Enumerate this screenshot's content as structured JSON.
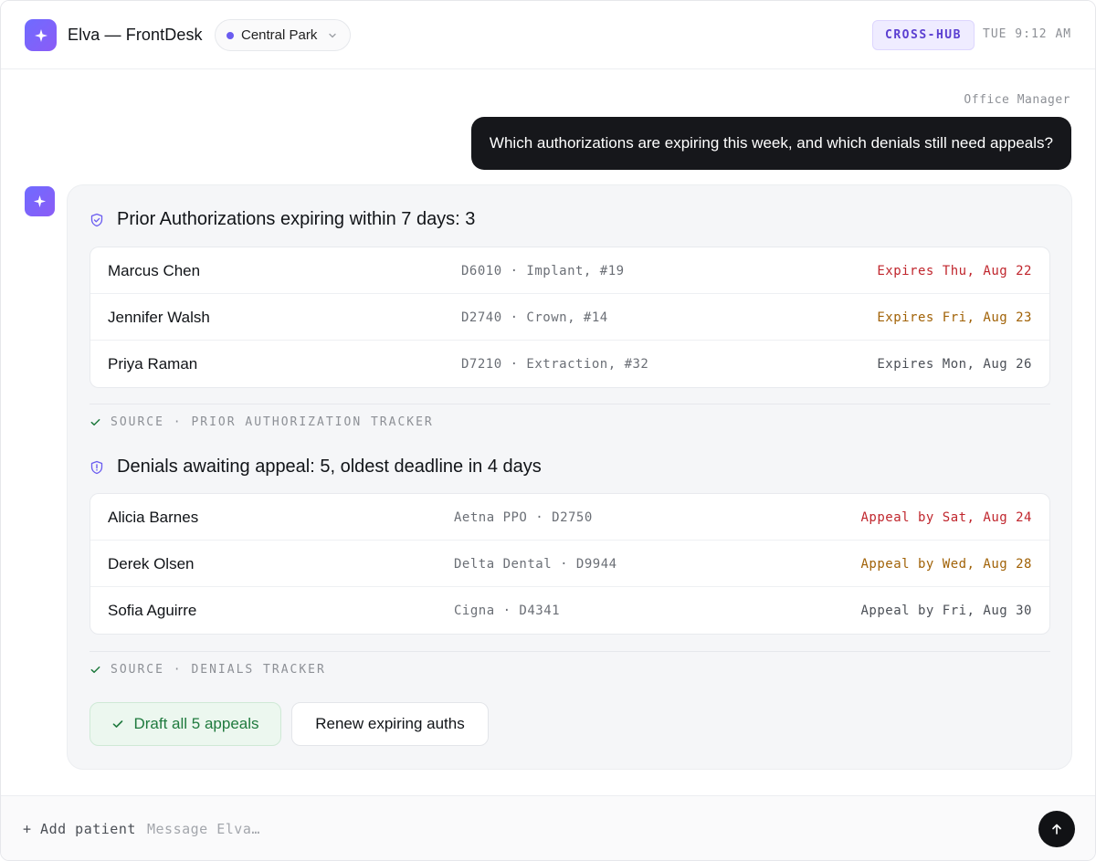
{
  "header": {
    "app_title": "Elva — FrontDesk",
    "location": "Central Park",
    "badge": "CROSS-HUB",
    "time": "TUE 9:12 AM"
  },
  "conversation": {
    "user_role": "Office Manager",
    "user_message": "Which authorizations are expiring this week, and which denials still need appeals?"
  },
  "auths": {
    "title": "Prior Authorizations expiring within 7 days: 3",
    "rows": [
      {
        "patient": "Marcus Chen",
        "procedure": "D6010 · Implant, #19",
        "status": "Expires Thu, Aug 22",
        "urgency": "critical"
      },
      {
        "patient": "Jennifer Walsh",
        "procedure": "D2740 · Crown, #14",
        "status": "Expires Fri, Aug 23",
        "urgency": "warning"
      },
      {
        "patient": "Priya Raman",
        "procedure": "D7210 · Extraction, #32",
        "status": "Expires Mon, Aug 26",
        "urgency": "normal"
      }
    ],
    "source": "SOURCE · PRIOR AUTHORIZATION TRACKER"
  },
  "denials": {
    "title": "Denials awaiting appeal: 5, oldest deadline in 4 days",
    "rows": [
      {
        "patient": "Alicia Barnes",
        "payer": "Aetna PPO · D2750",
        "status": "Appeal by Sat, Aug 24",
        "urgency": "critical"
      },
      {
        "patient": "Derek Olsen",
        "payer": "Delta Dental · D9944",
        "status": "Appeal by Wed, Aug 28",
        "urgency": "warning"
      },
      {
        "patient": "Sofia Aguirre",
        "payer": "Cigna · D4341",
        "status": "Appeal by Fri, Aug 30",
        "urgency": "normal"
      }
    ],
    "source": "SOURCE · DENIALS TRACKER"
  },
  "actions": {
    "draft_appeals": "Draft all 5 appeals",
    "renew_auths": "Renew expiring auths"
  },
  "composer": {
    "add_patient": "+ Add patient",
    "placeholder": "Message Elva…",
    "value": ""
  },
  "colors": {
    "accent": "#6a5cf0",
    "critical": "#c0262d",
    "warning": "#a16207",
    "normal": "#4b4f56",
    "success": "#1f7a3e"
  },
  "icons": {
    "logo": "sparkle-icon",
    "auth_section": "shield-check-icon",
    "denial_section": "shield-alert-icon",
    "source": "check-icon",
    "send": "arrow-up-icon"
  }
}
